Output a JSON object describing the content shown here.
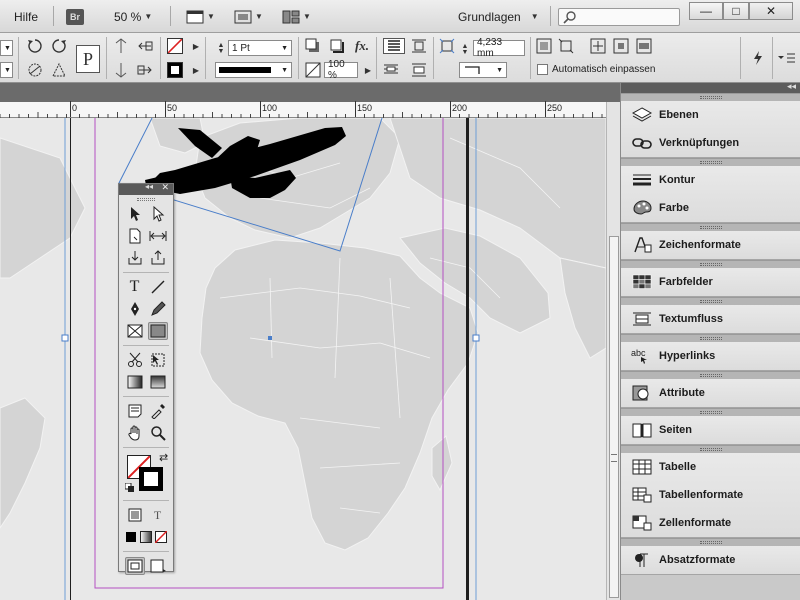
{
  "menubar": {
    "help_label": "Hilfe",
    "bridge_badge": "Br",
    "zoom": "50 %",
    "workspace": "Grundlagen",
    "search_placeholder": ""
  },
  "window_controls": {
    "minimize": "—",
    "restore": "□",
    "close": "✕"
  },
  "controlbar": {
    "text_tool_glyph": "P",
    "stroke_weight": "1 Pt",
    "opacity": "100 %",
    "fx_label": "fx.",
    "spacing_value": "4,233 mm",
    "autofit_label": "Automatisch einpassen",
    "autofit_checked": false
  },
  "ruler": {
    "labels": [
      "0",
      "50",
      "100",
      "150",
      "200",
      "250"
    ]
  },
  "panels": {
    "groups": [
      [
        {
          "label": "Ebenen",
          "icon": "layers-icon"
        },
        {
          "label": "Verknüpfungen",
          "icon": "links-icon"
        }
      ],
      [
        {
          "label": "Kontur",
          "icon": "stroke-icon"
        },
        {
          "label": "Farbe",
          "icon": "color-icon"
        }
      ],
      [
        {
          "label": "Zeichenformate",
          "icon": "character-styles-icon"
        }
      ],
      [
        {
          "label": "Farbfelder",
          "icon": "swatches-icon"
        }
      ],
      [
        {
          "label": "Textumfluss",
          "icon": "text-wrap-icon"
        }
      ],
      [
        {
          "label": "Hyperlinks",
          "icon": "hyperlinks-icon"
        }
      ],
      [
        {
          "label": "Attribute",
          "icon": "attributes-icon"
        }
      ],
      [
        {
          "label": "Seiten",
          "icon": "pages-icon"
        }
      ],
      [
        {
          "label": "Tabelle",
          "icon": "table-icon"
        },
        {
          "label": "Tabellenformate",
          "icon": "table-styles-icon"
        },
        {
          "label": "Zellenformate",
          "icon": "cell-styles-icon"
        }
      ],
      [
        {
          "label": "Absatzformate",
          "icon": "paragraph-styles-icon"
        }
      ]
    ]
  },
  "toolbox": {
    "text_tool": "T",
    "preview_tool": "T"
  },
  "colors": {
    "margin_guide": "#b54fc2",
    "bleed_guide": "#6e9ed6",
    "frame_line": "#1e1e1e",
    "map_land": "#d4d4d4"
  }
}
